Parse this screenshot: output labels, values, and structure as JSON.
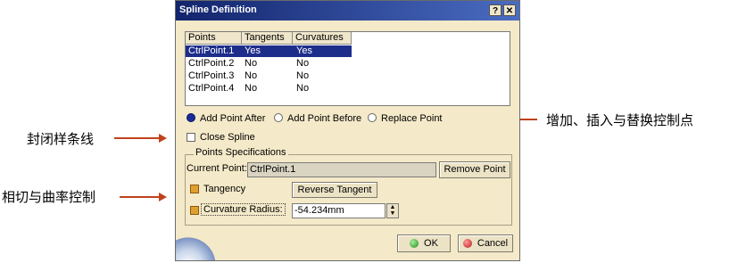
{
  "dialog": {
    "title": "Spline Definition",
    "help_button": "?",
    "close_button": "✕"
  },
  "table": {
    "columns": [
      "Points",
      "Tangents",
      "Curvatures"
    ],
    "rows": [
      {
        "point": "CtrlPoint.1",
        "tangent": "Yes",
        "curvature": "Yes",
        "selected": true
      },
      {
        "point": "CtrlPoint.2",
        "tangent": "No",
        "curvature": "No"
      },
      {
        "point": "CtrlPoint.3",
        "tangent": "No",
        "curvature": "No"
      },
      {
        "point": "CtrlPoint.4",
        "tangent": "No",
        "curvature": "No"
      }
    ]
  },
  "mode": {
    "options": [
      "Add Point After",
      "Add Point Before",
      "Replace Point"
    ],
    "selected": "Add Point After"
  },
  "close_spline": {
    "label": "Close Spline",
    "checked": false
  },
  "points_spec": {
    "group_label": "Points Specifications",
    "current_point_label": "Current Point:",
    "current_point_value": "CtrlPoint.1",
    "remove_point": "Remove Point",
    "tangency_label": "Tangency",
    "tangency_checked": true,
    "reverse_tangent": "Reverse Tangent",
    "curvature_label": "Curvature Radius:",
    "curvature_checked": true,
    "curvature_value": "-54.234mm"
  },
  "footer": {
    "ok": "OK",
    "cancel": "Cancel"
  },
  "annotations": {
    "add_insert_replace": "增加、插入与替换控制点",
    "close_spline": "封闭样条线",
    "tangency_curvature": "相切与曲率控制"
  },
  "colors": {
    "arrow": "#c0421c",
    "titlebar": "#12246c",
    "selection": "#1c2d8a"
  }
}
